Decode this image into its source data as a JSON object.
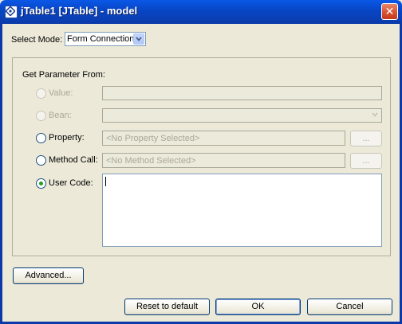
{
  "window": {
    "title": "jTable1 [JTable] - model",
    "close_label": "✕"
  },
  "select_mode": {
    "label": "Select Mode:",
    "value": "Form Connection"
  },
  "panel": {
    "title": "Get Parameter From:",
    "options": {
      "value": {
        "label": "Value:"
      },
      "bean": {
        "label": "Bean:"
      },
      "property": {
        "label": "Property:",
        "placeholder": "<No Property Selected>",
        "browse_label": "..."
      },
      "method_call": {
        "label": "Method Call:",
        "placeholder": "<No Method Selected>",
        "browse_label": "..."
      },
      "user_code": {
        "label": "User Code:",
        "value": ""
      }
    }
  },
  "buttons": {
    "advanced": "Advanced...",
    "reset": "Reset to default",
    "ok": "OK",
    "cancel": "Cancel"
  },
  "colors": {
    "titlebar": "#0a3fb4",
    "face": "#ece9d8",
    "selected_radio": "#21a121"
  }
}
